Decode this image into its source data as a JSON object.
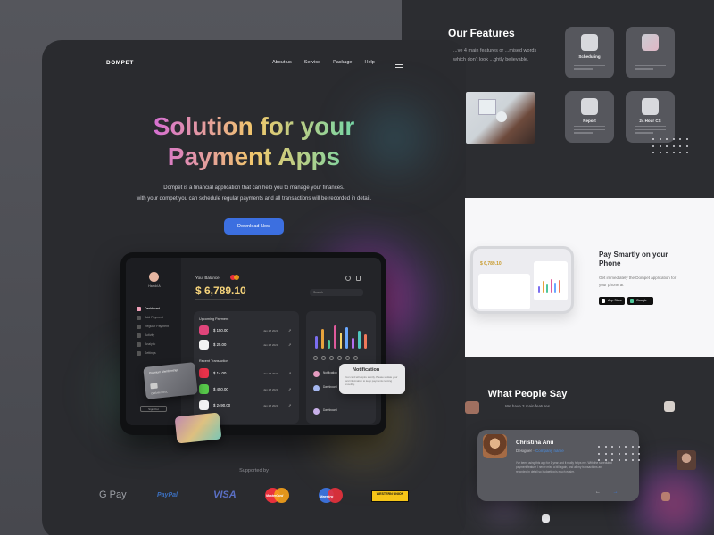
{
  "brand": "DOMPET",
  "nav": {
    "items": [
      "About us",
      "Service",
      "Package",
      "Help"
    ],
    "menu_icon": "hamburger-icon"
  },
  "hero": {
    "title_line1": "Solution for your",
    "title_line2": "Payment Apps",
    "description_line1": "Dompet is a financial application that can help you to manage your finances.",
    "description_line2": "with your dompet you can schedule regular payments and all transactions will be recorded in detail.",
    "cta": "Download Now"
  },
  "dashboard": {
    "user_name": "Harold A",
    "balance_label": "Your Balance",
    "balance": "$ 6,789.10",
    "search_placeholder": "Search",
    "menu": [
      "Dashboard",
      "Add Payment",
      "Regular Payment",
      "Activity",
      "Analytic",
      "Settings"
    ],
    "logout": "Sign Out",
    "upcoming_title": "Upcoming Payment",
    "upcoming": [
      {
        "amount": "$ 150.00",
        "date": "Jan 28 2021",
        "color": "#e0457b"
      },
      {
        "amount": "$ 25.00",
        "date": "Jan 28 2021",
        "color": "#f2f2f2"
      }
    ],
    "recent_title": "Recent Transaction",
    "recent": [
      {
        "amount": "$ 14.00",
        "date": "Jan 28 2021",
        "color": "#e8324a"
      },
      {
        "amount": "$ 450.00",
        "date": "Jan 28 2021",
        "color": "#57c84a"
      },
      {
        "amount": "$ 2490.00",
        "date": "Jan 28 2021",
        "color": "#f2f2f2"
      }
    ],
    "chart_rows": [
      "Notification",
      "Dashboard",
      "Dashboard"
    ],
    "notification_title": "Notification",
    "notification_text": "Your card will expire shortly. Please update your card information to keep payments running smoothly.",
    "card_label": "Premium Membership",
    "card_holder": "DREAM SOUL"
  },
  "supported": {
    "label": "Supported by",
    "logos": [
      "G Pay",
      "PayPal",
      "VISA",
      "MasterCard",
      "Maestro",
      "WESTERN UNION"
    ]
  },
  "features": {
    "title": "Our Features",
    "description": "...ve 4 main features or ...mised words which don't look ...ghtly believable.",
    "cards": [
      "Scheduling",
      "",
      "Report",
      "24 Hour CS"
    ]
  },
  "pay": {
    "title": "Pay Smartly on your Phone",
    "description": "Get immediately the Dompet application for your phone at",
    "phone_balance": "$ 6,789.10",
    "app_store": "App Store",
    "google_play": "Google Play"
  },
  "testimonials": {
    "title": "What People Say",
    "subtitle": "We have 3 main features",
    "name": "Christina Anu",
    "role": "Designer",
    "company": "Company name",
    "text": "I've been using this app for 1 year and it really helps me. With the scheduled payment feature I never miss a bill again, and all my transactions are recorded in detail so budgeting is much easier.",
    "prev": "←",
    "next": "→"
  },
  "colors": {
    "accent": "#3c6fe0",
    "balance": "#f5d37a",
    "panel": "#2a2b2f"
  }
}
